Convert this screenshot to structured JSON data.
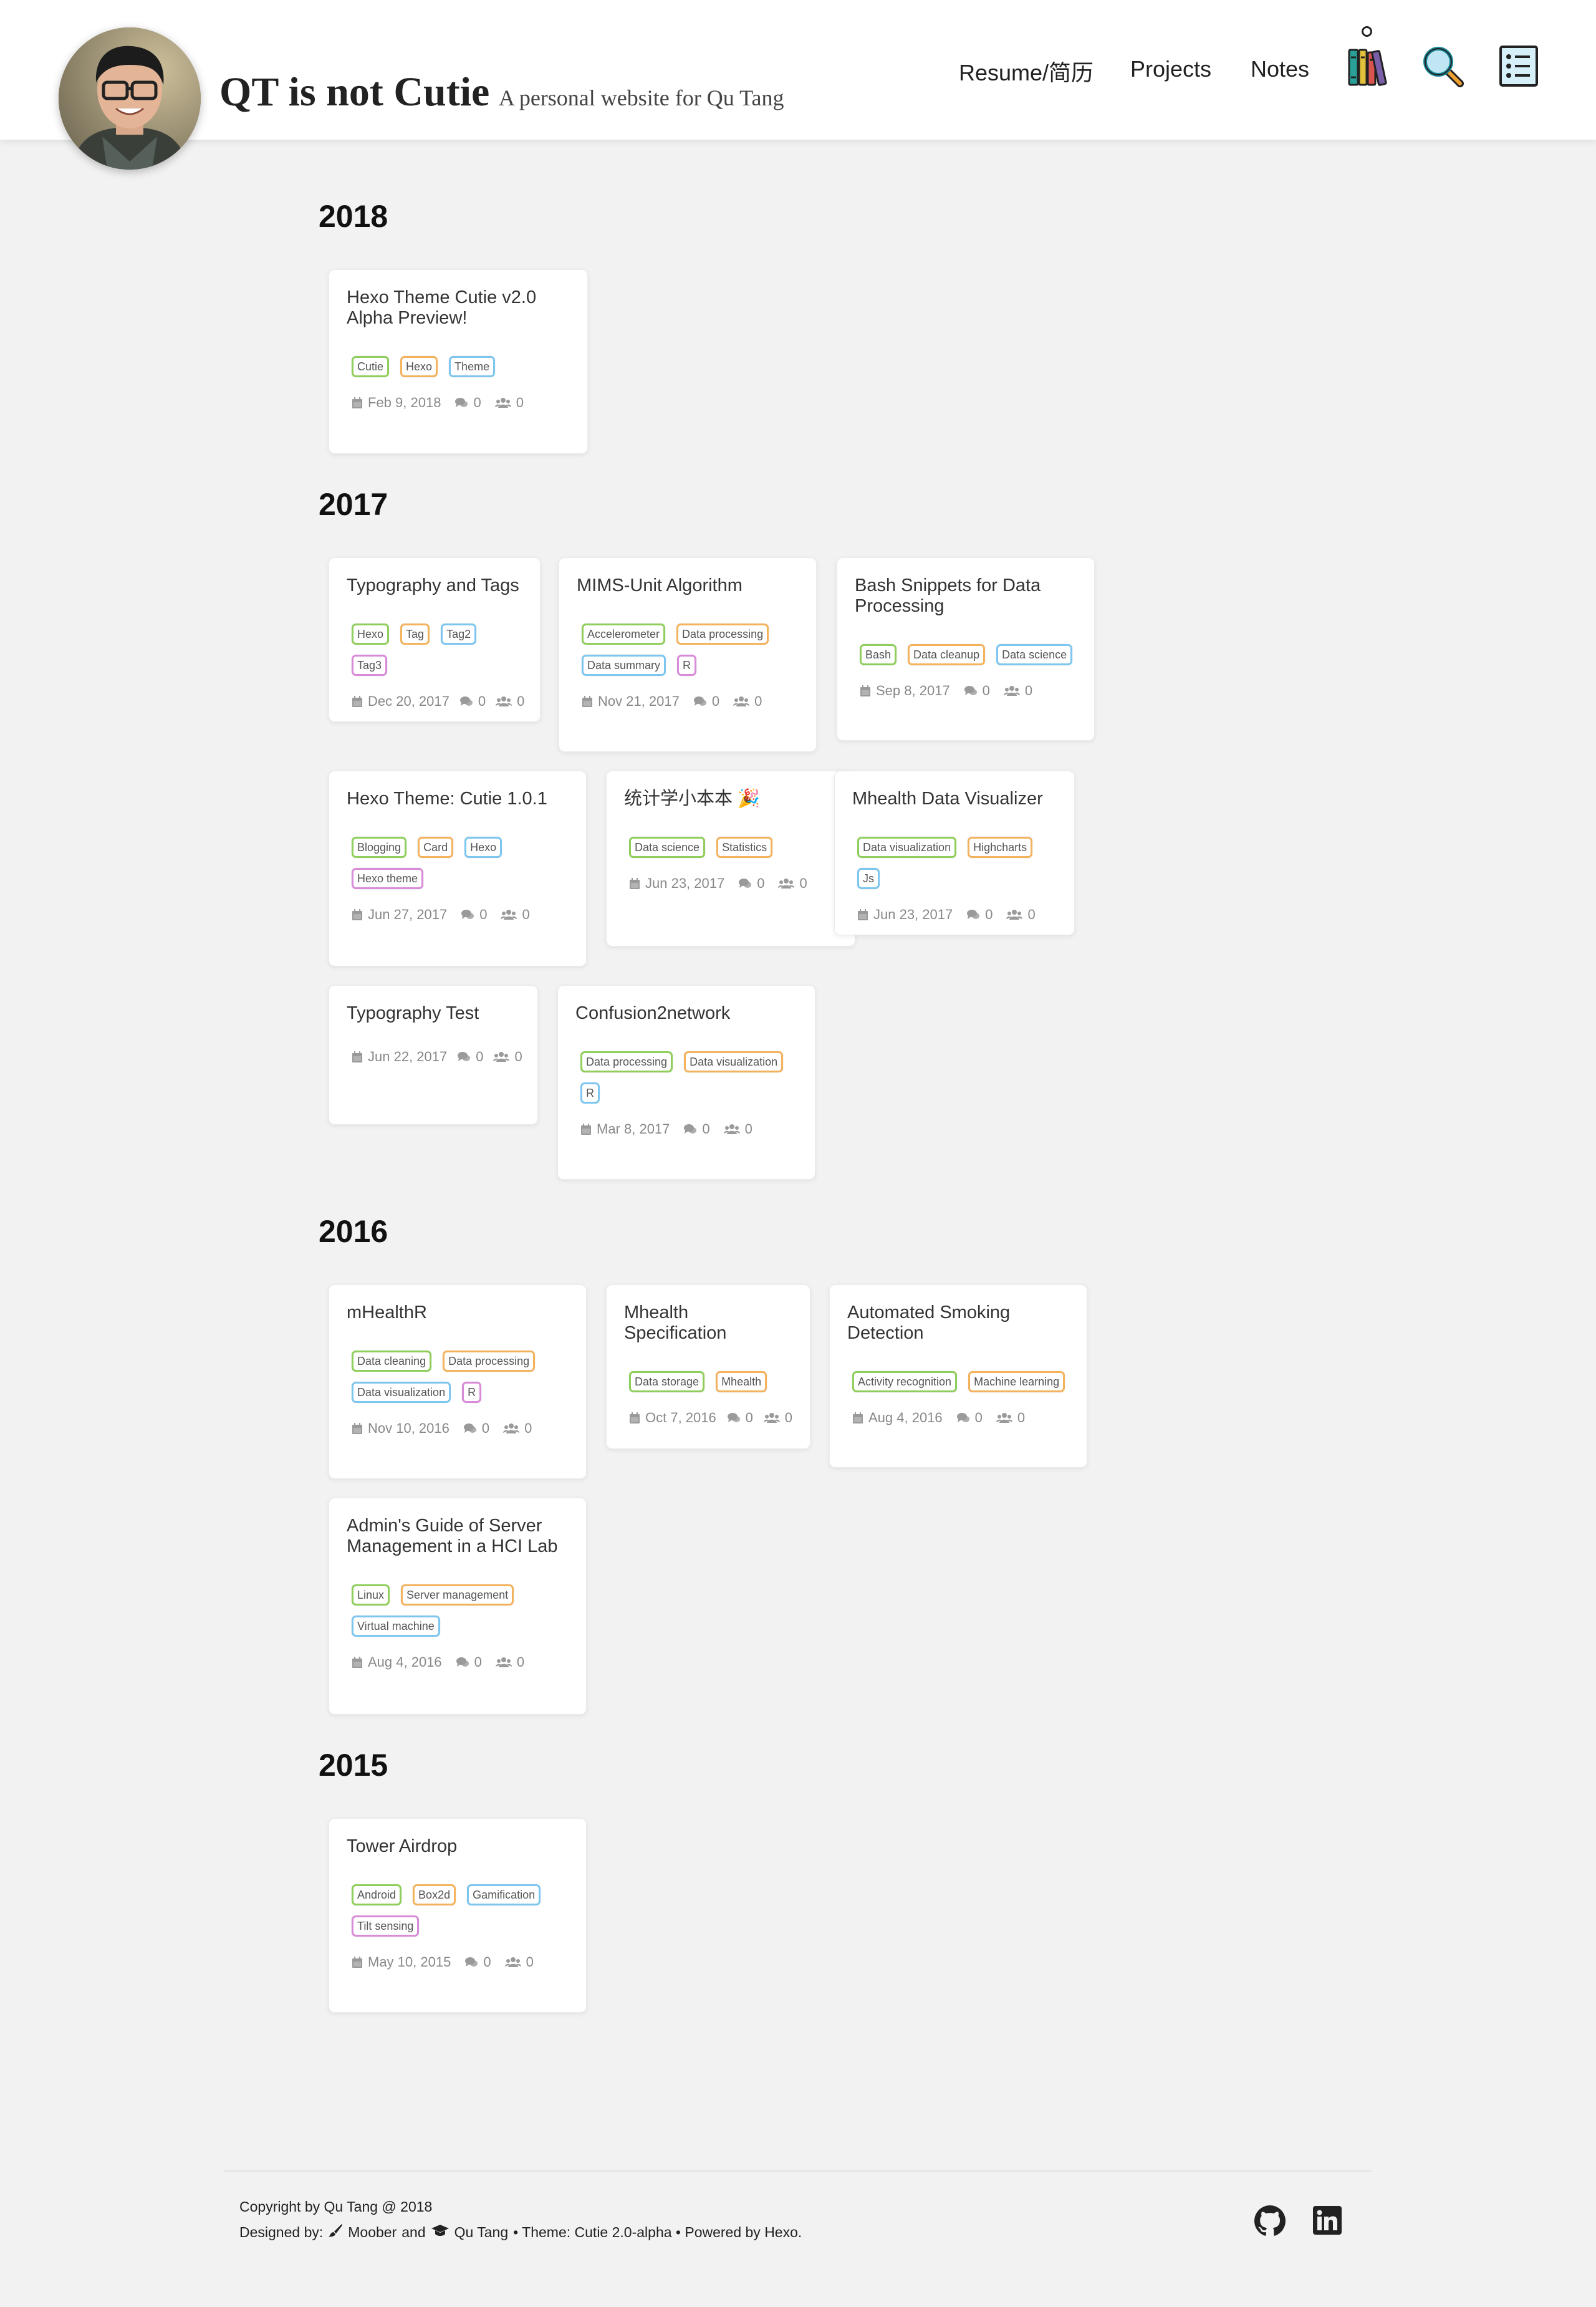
{
  "site": {
    "title": "QT is not Cutie",
    "subtitle": "A personal website for Qu Tang"
  },
  "nav": {
    "links": [
      "Resume/简历",
      "Projects",
      "Notes"
    ],
    "icons": [
      "archive-books-icon",
      "search-icon",
      "table-of-contents-icon"
    ]
  },
  "years": [
    "2018",
    "2017",
    "2016",
    "2015"
  ],
  "posts": [
    {
      "title": "Hexo Theme Cutie v2.0 Alpha Preview!",
      "tags": [
        "Cutie",
        "Hexo",
        "Theme"
      ],
      "date": "Feb 9, 2018",
      "comments": "0",
      "visitors": "0"
    },
    {
      "title": "Typography and Tags",
      "tags": [
        "Hexo",
        "Tag",
        "Tag2",
        "Tag3"
      ],
      "date": "Dec 20, 2017",
      "comments": "0",
      "visitors": "0"
    },
    {
      "title": "MIMS-Unit Algorithm",
      "tags": [
        "Accelerometer",
        "Data processing",
        "Data summary",
        "R"
      ],
      "date": "Nov 21, 2017",
      "comments": "0",
      "visitors": "0"
    },
    {
      "title": "Bash Snippets for Data Processing",
      "tags": [
        "Bash",
        "Data cleanup",
        "Data science"
      ],
      "date": "Sep 8, 2017",
      "comments": "0",
      "visitors": "0"
    },
    {
      "title": "Hexo Theme: Cutie 1.0.1",
      "tags": [
        "Blogging",
        "Card",
        "Hexo",
        "Hexo theme"
      ],
      "date": "Jun 27, 2017",
      "comments": "0",
      "visitors": "0"
    },
    {
      "title": "统计学小本本 🎉",
      "tags": [
        "Data science",
        "Statistics"
      ],
      "date": "Jun 23, 2017",
      "comments": "0",
      "visitors": "0"
    },
    {
      "title": "Mhealth Data Visualizer",
      "tags": [
        "Data visualization",
        "Highcharts",
        "Js"
      ],
      "date": "Jun 23, 2017",
      "comments": "0",
      "visitors": "0"
    },
    {
      "title": "Typography Test",
      "tags": [],
      "date": "Jun 22, 2017",
      "comments": "0",
      "visitors": "0"
    },
    {
      "title": "Confusion2network",
      "tags": [
        "Data processing",
        "Data visualization",
        "R"
      ],
      "date": "Mar 8, 2017",
      "comments": "0",
      "visitors": "0"
    },
    {
      "title": "mHealthR",
      "tags": [
        "Data cleaning",
        "Data processing",
        "Data visualization",
        "R"
      ],
      "date": "Nov 10, 2016",
      "comments": "0",
      "visitors": "0"
    },
    {
      "title": "Mhealth Specification",
      "tags": [
        "Data storage",
        "Mhealth"
      ],
      "date": "Oct 7, 2016",
      "comments": "0",
      "visitors": "0"
    },
    {
      "title": "Automated Smoking Detection",
      "tags": [
        "Activity recognition",
        "Machine learning"
      ],
      "date": "Aug 4, 2016",
      "comments": "0",
      "visitors": "0"
    },
    {
      "title": "Admin's Guide of Server Management in a HCI Lab",
      "tags": [
        "Linux",
        "Server management",
        "Virtual machine"
      ],
      "date": "Aug 4, 2016",
      "comments": "0",
      "visitors": "0"
    },
    {
      "title": "Tower Airdrop",
      "tags": [
        "Android",
        "Box2d",
        "Gamification",
        "Tilt sensing"
      ],
      "date": "May 10, 2015",
      "comments": "0",
      "visitors": "0"
    }
  ],
  "tag_colors": [
    "#8fce5a",
    "#f4b25c",
    "#7cc6ef",
    "#d98ad9"
  ],
  "footer": {
    "copyright": "Copyright by Qu Tang @ 2018",
    "designed_prefix": "Designed by:",
    "designer1": "Moober",
    "and": "and",
    "designer2": "Qu Tang",
    "theme": "• Theme: Cutie 2.0-alpha • Powered by Hexo.",
    "icons": [
      "github-icon",
      "linkedin-icon"
    ]
  }
}
